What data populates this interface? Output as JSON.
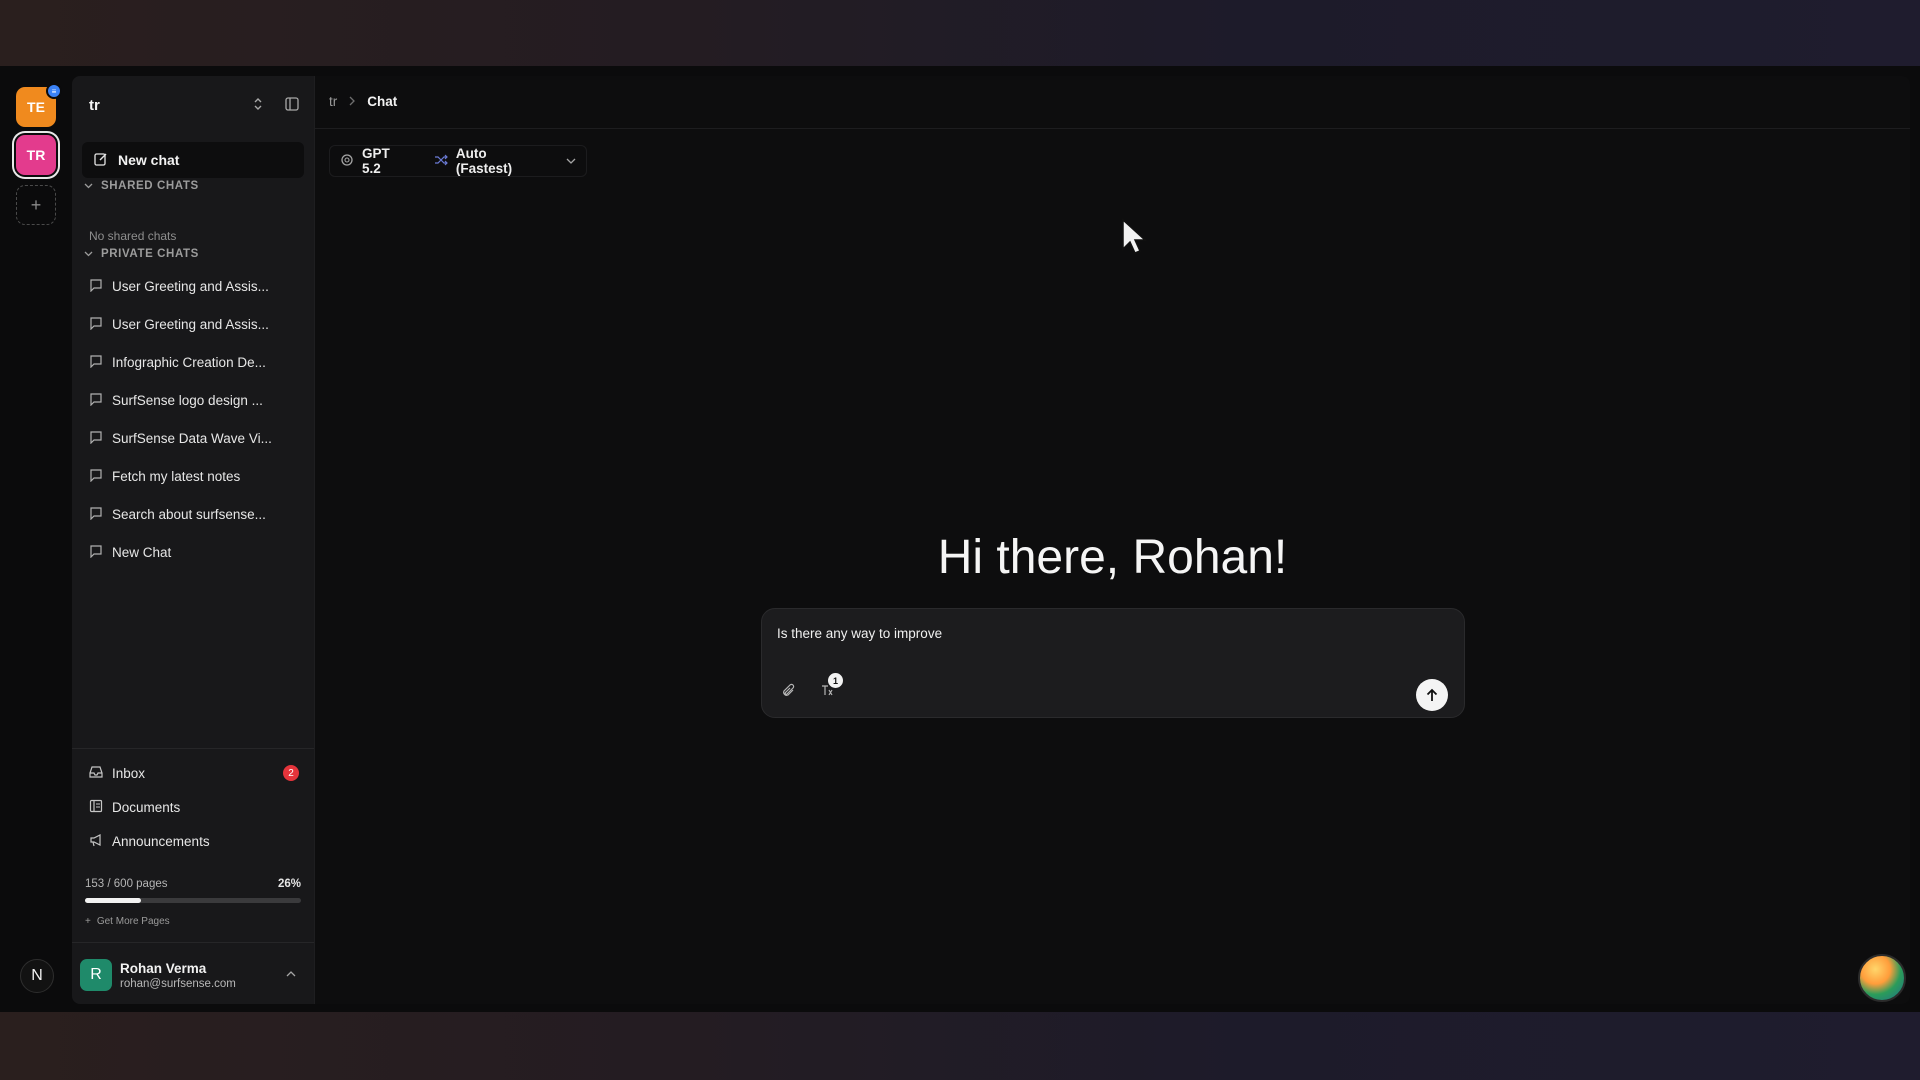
{
  "workspaces": [
    {
      "initials": "TE",
      "color": "#f08a1e",
      "badge": "≡"
    },
    {
      "initials": "TR",
      "color": "#e33b8d"
    }
  ],
  "workspace_add": "+",
  "bottom_logo": "N",
  "sidebar": {
    "title": "tr",
    "new_chat_label": "New chat",
    "shared_label": "SHARED CHATS",
    "no_shared": "No shared chats",
    "private_label": "PRIVATE CHATS",
    "chats": [
      "User Greeting and Assis...",
      "User Greeting and Assis...",
      "Infographic Creation De...",
      "SurfSense logo design ...",
      "SurfSense Data Wave Vi...",
      "Fetch my latest notes",
      "Search about surfsense...",
      "New Chat"
    ],
    "nav": {
      "inbox": "Inbox",
      "inbox_count": "2",
      "documents": "Documents",
      "announcements": "Announcements"
    },
    "usage": {
      "text": "153 / 600 pages",
      "percent_label": "26%",
      "fraction": 0.26,
      "get_more": "Get More Pages"
    },
    "user": {
      "initial": "R",
      "name": "Rohan Verma",
      "email": "rohan@surfsense.com"
    }
  },
  "main": {
    "breadcrumb": [
      "tr",
      "Chat"
    ],
    "model": "GPT 5.2",
    "mode": "Auto (Fastest)",
    "greeting": "Hi there, Rohan!",
    "composer": {
      "text": "Is there any way to improve",
      "tools_count": "1"
    }
  }
}
